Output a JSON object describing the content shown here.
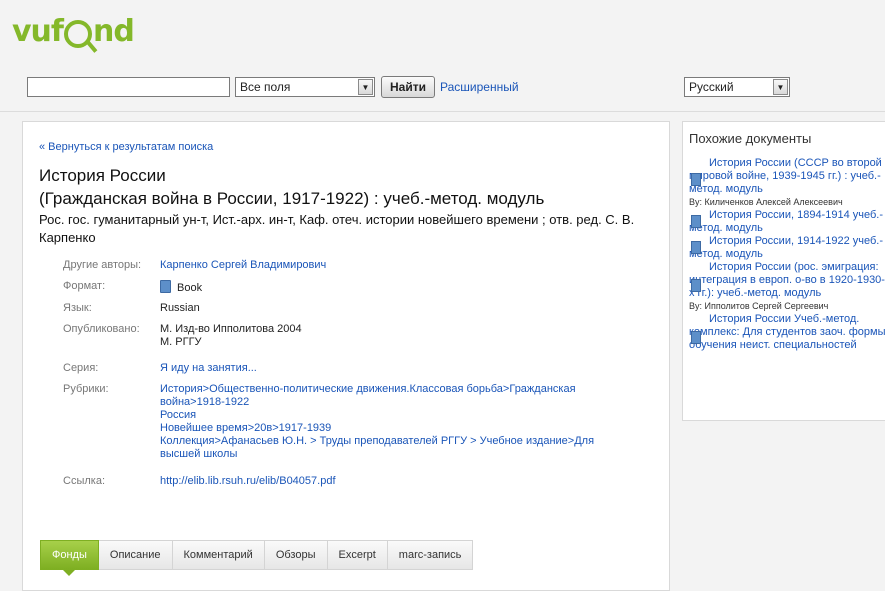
{
  "logo": {
    "part1": "vuf",
    "part2": "nd"
  },
  "search": {
    "input_value": "",
    "field_select": "Все поля",
    "button": "Найти",
    "advanced_link": "Расширенный",
    "language": "Русский"
  },
  "record": {
    "back_link": "« Вернуться к результатам поиска",
    "title": "История России",
    "subtitle": "(Гражданская война в России, 1917-1922) : учеб.-метод. модуль",
    "responsibility": "Рос. гос. гуманитарный ун-т, Ист.-арх. ин-т, Каф. отеч. истории новейшего времени ; отв. ред. С. В. Карпенко",
    "details": {
      "authors_label": "Другие авторы:",
      "authors_value": "Карпенко Сергей Владимирович",
      "format_label": "Формат:",
      "format_value": "Book",
      "language_label": "Язык:",
      "language_value": "Russian",
      "published_label": "Опубликовано:",
      "published_line1": "М. Изд-во Ипполитова 2004",
      "published_line2": "М. РГГУ",
      "series_label": "Серия:",
      "series_value": "Я иду на занятия...",
      "subjects_label": "Рубрики:",
      "subjects": [
        "История>Общественно-политические движения.Классовая борьба>Гражданская война>1918-1922",
        "Россия",
        "Новейшее время>20в>1917-1939",
        "Коллекция>Афанасьев Ю.Н. > Труды преподавателей РГГУ > Учебное издание>Для высшей школы"
      ],
      "link_label": "Ссылка:",
      "link_value": "http://elib.lib.rsuh.ru/elib/B04057.pdf"
    },
    "tabs": [
      "Фонды",
      "Описание",
      "Комментарий",
      "Обзоры",
      "Excerpt",
      "marc-запись"
    ]
  },
  "similar": {
    "title": "Похожие документы",
    "items": [
      {
        "title": "История России (СССР во второй мировой войне, 1939-1945 гг.) : учеб.-метод. модуль",
        "by": "By: Киличенков Алексей Алексеевич"
      },
      {
        "title": "История России, 1894-1914 учеб.-метод. модуль",
        "by": ""
      },
      {
        "title": "История России, 1914-1922 учеб.-метод. модуль",
        "by": ""
      },
      {
        "title": "История России (рос. эмиграция: интеграция в европ. о-во в 1920-1930-х гг.): учеб.-метод. модуль",
        "by": "By: Ипполитов Сергей Сергеевич"
      },
      {
        "title": "История России Учеб.-метод. комплекс: Для студентов заоч. формы обучения неист. специальностей",
        "by": ""
      }
    ]
  },
  "colors": {
    "accent_green": "#7eaf22",
    "link_blue": "#1a55b8"
  }
}
